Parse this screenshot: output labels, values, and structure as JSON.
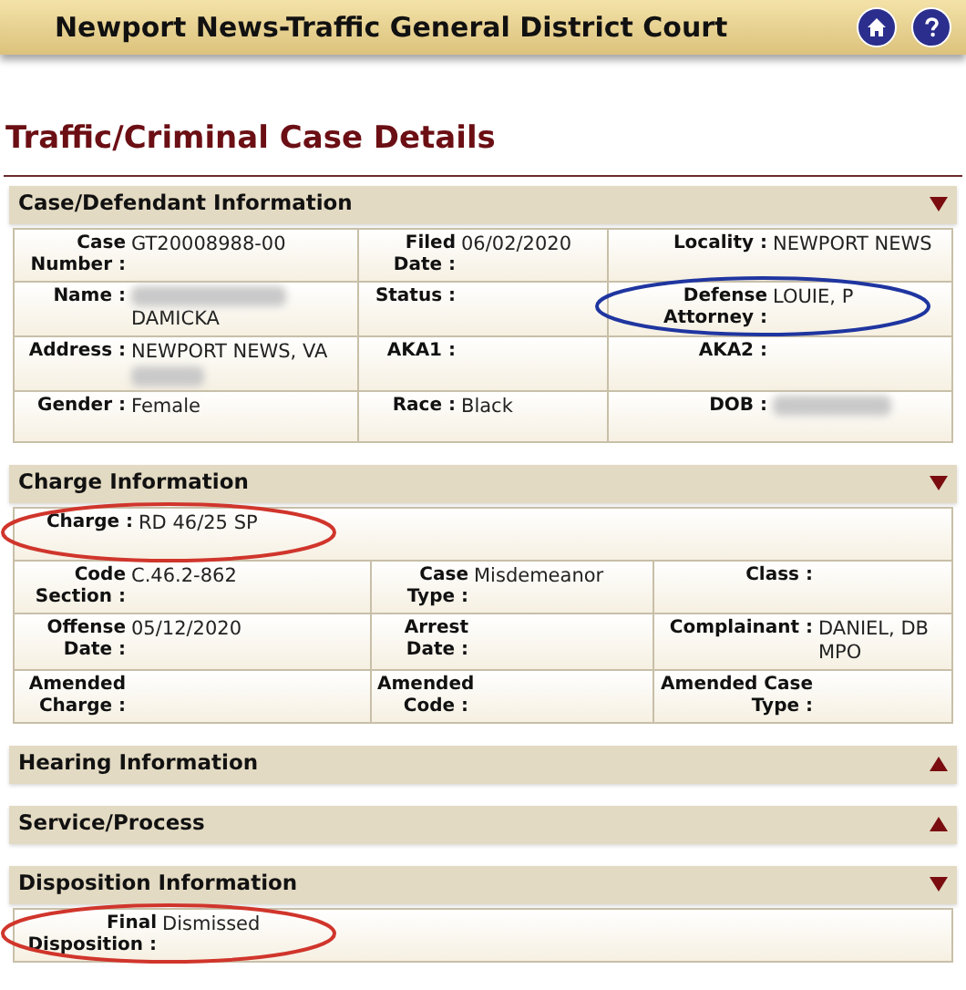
{
  "header": {
    "title": "Newport News-Traffic General District Court"
  },
  "page_title": "Traffic/Criminal Case Details",
  "sections": [
    {
      "title": "Case/Defendant Information",
      "expanded": true,
      "rows": [
        {
          "fields": [
            {
              "label": "Case Number :",
              "value": "GT20008988-00"
            },
            {
              "label": "Filed Date :",
              "value": "06/02/2020"
            },
            {
              "label": "Locality :",
              "value": "NEWPORT NEWS"
            }
          ]
        },
        {
          "fields": [
            {
              "label": "Name :",
              "value": "DAMICKA",
              "redacted_prefix": true
            },
            {
              "label": "Status :"
            },
            {
              "label": "Defense Attorney :",
              "value": "LOUIE, P",
              "color": "#1f35a0"
            }
          ]
        },
        {
          "fields": [
            {
              "label": "Address :",
              "value": "NEWPORT NEWS, VA",
              "redacted_suffix": true
            },
            {
              "label": "AKA1 :"
            },
            {
              "label": "AKA2 :"
            }
          ]
        },
        {
          "fields": [
            {
              "label": "Gender :",
              "value": "Female"
            },
            {
              "label": "Race :",
              "value": "Black"
            },
            {
              "label": "DOB :",
              "redacted": true
            }
          ]
        }
      ]
    },
    {
      "title": "Charge Information",
      "expanded": true,
      "rows": [
        {
          "fields": [
            {
              "label": "Charge :",
              "value": "RD 46/25 SP",
              "color": "#d0352b"
            }
          ]
        },
        {
          "fields": [
            {
              "label": "Code Section :",
              "value": "C.46.2-862"
            },
            {
              "label": "Case Type :",
              "value": "Misdemeanor"
            },
            {
              "label": "Class :"
            }
          ]
        },
        {
          "fields": [
            {
              "label": "Offense Date :",
              "value": "05/12/2020"
            },
            {
              "label": "Arrest Date :"
            },
            {
              "label": "Complainant :",
              "value": "DANIEL, DB MPO"
            }
          ]
        },
        {
          "fields": [
            {
              "label": "Amended Charge :"
            },
            {
              "label": "Amended Code :"
            },
            {
              "label": "Amended Case Type :"
            }
          ]
        }
      ]
    },
    {
      "title": "Hearing Information",
      "expanded": false
    },
    {
      "title": "Service/Process",
      "expanded": false
    },
    {
      "title": "Disposition Information",
      "expanded": true,
      "rows": [
        {
          "fields": [
            {
              "label": "Final Disposition :",
              "value": "Dismissed",
              "color": "#d0352b"
            }
          ]
        }
      ]
    }
  ]
}
